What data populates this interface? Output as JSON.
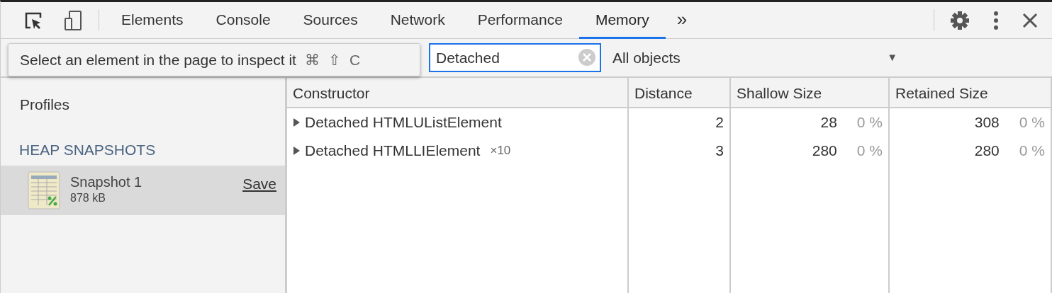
{
  "tabs": [
    {
      "label": "Elements",
      "selected": false
    },
    {
      "label": "Console",
      "selected": false
    },
    {
      "label": "Sources",
      "selected": false
    },
    {
      "label": "Network",
      "selected": false
    },
    {
      "label": "Performance",
      "selected": false
    },
    {
      "label": "Memory",
      "selected": true
    }
  ],
  "more_tabs": "»",
  "tooltip": {
    "text": "Select an element in the page to inspect it",
    "keys": [
      "⌘",
      "⇧",
      "C"
    ]
  },
  "filter": {
    "value": "Detached"
  },
  "view_select": {
    "value": "All objects",
    "arrow": "▼"
  },
  "sidebar": {
    "title": "Profiles",
    "section": "HEAP SNAPSHOTS",
    "items": [
      {
        "title": "Snapshot 1",
        "size": "878 kB",
        "action": "Save",
        "selected": true
      }
    ]
  },
  "table": {
    "columns": [
      "Constructor",
      "Distance",
      "Shallow Size",
      "Retained Size"
    ],
    "rows": [
      {
        "name": "Detached HTMLUListElement",
        "count": "",
        "expanded": false,
        "distance": "2",
        "shallow": "28",
        "shallow_pct": "0 %",
        "retained": "308",
        "retained_pct": "0 %"
      },
      {
        "name": "Detached HTMLLIElement",
        "count": "×10",
        "expanded": false,
        "distance": "3",
        "shallow": "280",
        "shallow_pct": "0 %",
        "retained": "280",
        "retained_pct": "0 %"
      }
    ]
  }
}
